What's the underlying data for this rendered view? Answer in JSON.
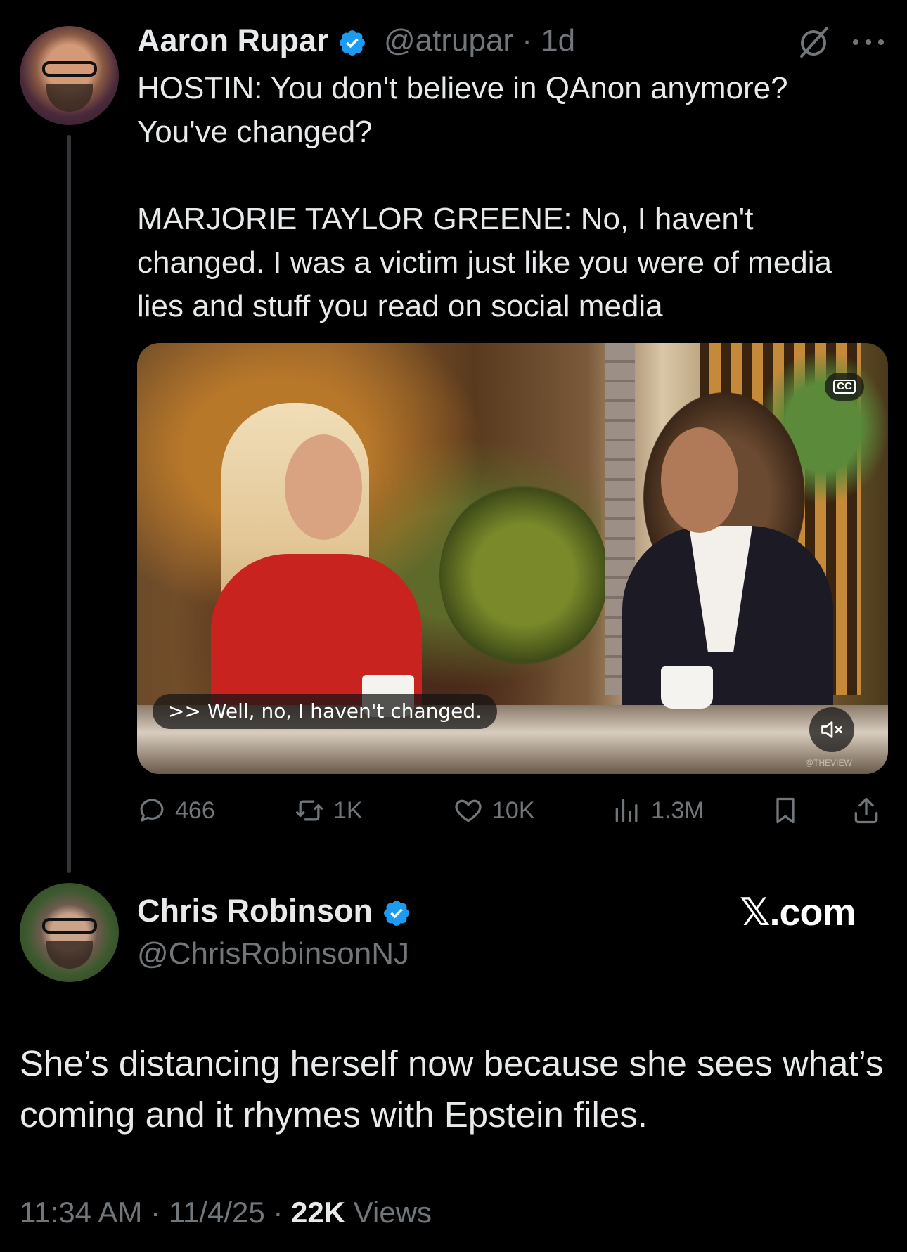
{
  "tweet": {
    "author_name": "Aaron Rupar",
    "author_handle": "@atrupar",
    "time_ago": "1d",
    "text": "HOSTIN: You don't believe in QAnon anymore? You've changed?\n\nMARJORIE TAYLOR GREENE: No, I haven't changed. I was a victim just like you were of media lies and stuff you read on social media",
    "verified": true,
    "video": {
      "caption": ">> Well, no, I haven't changed.",
      "cc_label": "CC",
      "watermark": "@THEVIEW"
    },
    "stats": {
      "replies": "466",
      "reposts": "1K",
      "likes": "10K",
      "views": "1.3M"
    }
  },
  "reply": {
    "author_name": "Chris Robinson",
    "author_handle": "@ChrisRobinsonNJ",
    "verified": true,
    "text": "She’s distancing herself now because she sees what’s coming and it rhymes with Epstein files.",
    "time": "11:34 AM",
    "date": "11/4/25",
    "views_count": "22K",
    "views_label": "Views",
    "sep": "·"
  },
  "brand": {
    "logo_text": "X.com",
    "logo_x": "𝕏",
    "logo_suffix": ".com"
  },
  "colors": {
    "background": "#000000",
    "text": "#e7e9ea",
    "secondary": "#71767b",
    "verified": "#1d9bf0"
  }
}
